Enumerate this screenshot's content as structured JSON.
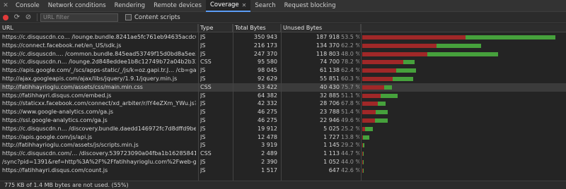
{
  "tabs": [
    {
      "label": "Console"
    },
    {
      "label": "Network conditions"
    },
    {
      "label": "Rendering"
    },
    {
      "label": "Remote devices"
    },
    {
      "label": "Coverage",
      "active": true
    },
    {
      "label": "Search"
    },
    {
      "label": "Request blocking"
    }
  ],
  "toolbar": {
    "filter_placeholder": "URL filter",
    "content_scripts_label": "Content scripts"
  },
  "columns": {
    "url": "URL",
    "type": "Type",
    "total": "Total Bytes",
    "unused": "Unused Bytes"
  },
  "colors": {
    "unused": "#a02828",
    "used": "#46a13c",
    "record": "#e03a3a"
  },
  "rows": [
    {
      "url": "https://c.disquscdn.co…  /lounge.bundle.8241ae5fc761eb94635acdc63f5fd29f.js",
      "type": "JS",
      "total": "350 943",
      "unused": "187 918",
      "pct": "53.5 %",
      "total_bytes": 350943,
      "unused_bytes": 187918
    },
    {
      "url": "https://connect.facebook.net/en_US/sdk.js",
      "type": "JS",
      "total": "216 173",
      "unused": "134 370",
      "pct": "62.2 %",
      "total_bytes": 216173,
      "unused_bytes": 134370
    },
    {
      "url": "https://c.disquscdn.…  /common.bundle.845ead53749f15d0bd8a5ee344c8f06e.js",
      "type": "JS",
      "total": "247 370",
      "unused": "118 803",
      "pct": "48.0 %",
      "total_bytes": 247370,
      "unused_bytes": 118803
    },
    {
      "url": "https://c.disquscdn.n…  /lounge.2d848eddee1b8c12749b72a04b2b33dc.css",
      "type": "CSS",
      "total": "95 580",
      "unused": "74 700",
      "pct": "78.2 %",
      "total_bytes": 95580,
      "unused_bytes": 74700
    },
    {
      "url": "https://apis.google.com/_/scs/apps-static/_/js/k=oz.gapi.tr.J…  /cb=gapi.loaded_0",
      "type": "JS",
      "total": "98 045",
      "unused": "61 138",
      "pct": "62.4 %",
      "total_bytes": 98045,
      "unused_bytes": 61138
    },
    {
      "url": "http://ajax.googleapis.com/ajax/libs/jquery/1.9.1/jquery.min.js",
      "type": "JS",
      "total": "92 629",
      "unused": "55 851",
      "pct": "60.3 %",
      "total_bytes": 92629,
      "unused_bytes": 55851
    },
    {
      "url": "http://fatihhayrioglu.com/assets/css/main.min.css",
      "type": "CSS",
      "total": "53 422",
      "unused": "40 430",
      "pct": "75.7 %",
      "total_bytes": 53422,
      "unused_bytes": 40430,
      "highlight": true
    },
    {
      "url": "https://fatihhayri.disqus.com/embed.js",
      "type": "JS",
      "total": "64 382",
      "unused": "32 885",
      "pct": "51.1 %",
      "total_bytes": 64382,
      "unused_bytes": 32885
    },
    {
      "url": "https://staticxx.facebook.com/connect/xd_arbiter/r/lY4eZXm_YWu.js?version=42",
      "type": "JS",
      "total": "42 332",
      "unused": "28 706",
      "pct": "67.8 %",
      "total_bytes": 42332,
      "unused_bytes": 28706
    },
    {
      "url": "https://www.google-analytics.com/ga.js",
      "type": "JS",
      "total": "46 275",
      "unused": "23 788",
      "pct": "51.4 %",
      "total_bytes": 46275,
      "unused_bytes": 23788
    },
    {
      "url": "https://ssl.google-analytics.com/ga.js",
      "type": "JS",
      "total": "46 275",
      "unused": "22 946",
      "pct": "49.6 %",
      "total_bytes": 46275,
      "unused_bytes": 22946
    },
    {
      "url": "https://c.disquscdn.n…  /discovery.bundle.daedd146972fc7d8dffd9be34c404865.js",
      "type": "JS",
      "total": "19 912",
      "unused": "5 025",
      "pct": "25.2 %",
      "total_bytes": 19912,
      "unused_bytes": 5025
    },
    {
      "url": "https://apis.google.com/js/api.js",
      "type": "JS",
      "total": "12 478",
      "unused": "1 727",
      "pct": "13.8 %",
      "total_bytes": 12478,
      "unused_bytes": 1727
    },
    {
      "url": "http://fatihhayrioglu.com/assets/js/scripts.min.js",
      "type": "JS",
      "total": "3 919",
      "unused": "1 145",
      "pct": "29.2 %",
      "total_bytes": 3919,
      "unused_bytes": 1145
    },
    {
      "url": "https://c.disquscdn.com/…  /discovery.539723090a04fba1b162858415868357.css",
      "type": "CSS",
      "total": "2 489",
      "unused": "1 113",
      "pct": "44.7 %",
      "total_bytes": 2489,
      "unused_bytes": 1113
    },
    {
      "url": "/sync?pid=1391&ref=http%3A%2F%2Ffatihhayrioglu.com%2Fweb-gelistiriciler-ic",
      "type": "JS",
      "total": "2 390",
      "unused": "1 052",
      "pct": "44.0 %",
      "total_bytes": 2390,
      "unused_bytes": 1052
    },
    {
      "url": "https://fatihhayri.disqus.com/count.js",
      "type": "JS",
      "total": "1 517",
      "unused": "647",
      "pct": "42.6 %",
      "total_bytes": 1517,
      "unused_bytes": 647
    }
  ],
  "status": "775 KB of 1.4 MB bytes are not used. (55%)"
}
